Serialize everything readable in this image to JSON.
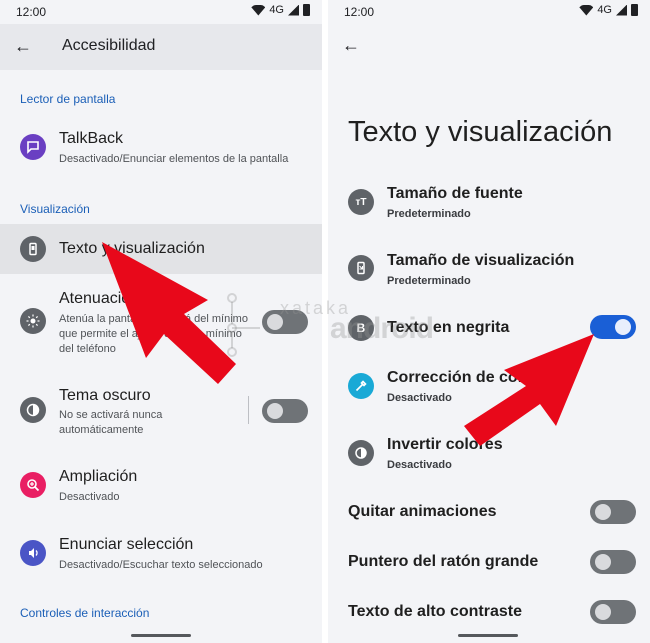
{
  "left": {
    "status": {
      "time": "12:00",
      "network": "4G"
    },
    "appbar": {
      "title": "Accesibilidad"
    },
    "sections": {
      "screen_reader": "Lector de pantalla",
      "display": "Visualización",
      "interaction": "Controles de interacción"
    },
    "items": {
      "talkback": {
        "title": "TalkBack",
        "subtitle": "Desactivado/Enunciar elementos de la pantalla"
      },
      "text_display": {
        "title": "Texto y visualización"
      },
      "extra_dim": {
        "title": "Atenuación extra",
        "subtitle": "Atenúa la pantalla más allá del mínimo que permite el ajuste de brillo mínimo del teléfono",
        "enabled": false
      },
      "dark_theme": {
        "title": "Tema oscuro",
        "subtitle": "No se activará nunca automáticamente",
        "enabled": false
      },
      "magnification": {
        "title": "Ampliación",
        "subtitle": "Desactivado"
      },
      "select_to_speak": {
        "title": "Enunciar selección",
        "subtitle": "Desactivado/Escuchar texto seleccionado"
      }
    }
  },
  "right": {
    "status": {
      "time": "12:00",
      "network": "4G"
    },
    "page_title": "Texto y visualización",
    "items": {
      "font_size": {
        "icon_glyph": "тT",
        "title": "Tamaño de fuente",
        "subtitle": "Predeterminado"
      },
      "display_size": {
        "title": "Tamaño de visualización",
        "subtitle": "Predeterminado"
      },
      "bold_text": {
        "icon_glyph": "B",
        "title": "Texto en negrita",
        "enabled": true
      },
      "color_correction": {
        "title": "Corrección de color",
        "subtitle": "Desactivado"
      },
      "color_inversion": {
        "title": "Invertir colores",
        "subtitle": "Desactivado"
      },
      "remove_animations": {
        "title": "Quitar animaciones",
        "enabled": false
      },
      "large_pointer": {
        "title": "Puntero del ratón grande",
        "enabled": false
      },
      "high_contrast": {
        "title": "Texto de alto contraste",
        "enabled": false
      }
    }
  },
  "watermark": {
    "text": "android",
    "logo_text": "xataka"
  },
  "colors": {
    "accent": "#1b5fb7",
    "toggle_on": "#1a5fd6",
    "talkback_icon": "#6a3fc2",
    "magnification_icon": "#e91e63",
    "select_speak_icon": "#4a55c6",
    "color_correction_icon": "#19a9d6",
    "arrow": "#e8081a"
  }
}
